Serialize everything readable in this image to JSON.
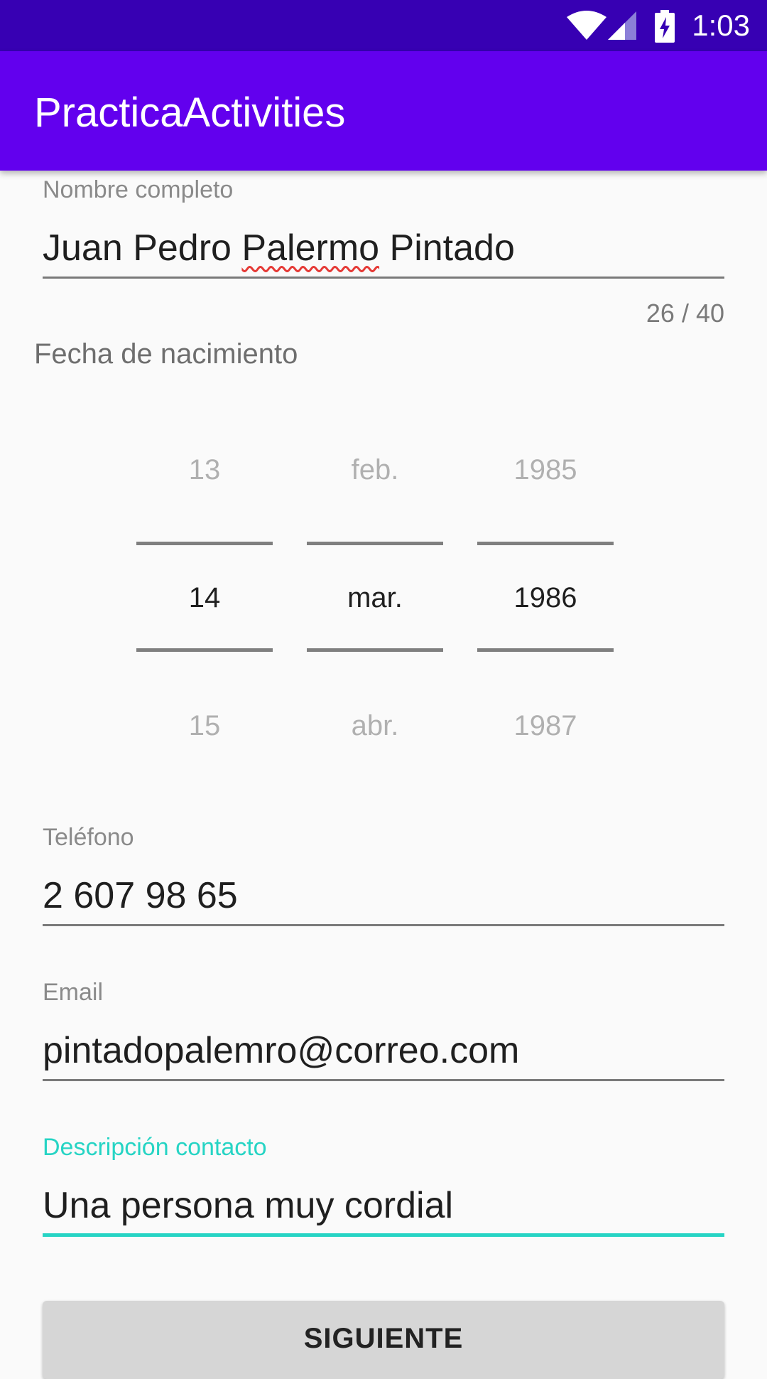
{
  "status_bar": {
    "time": "1:03",
    "icons": [
      "wifi-icon",
      "signal-icon",
      "battery-charging-icon"
    ],
    "background": "#3700b3"
  },
  "app_bar": {
    "title": "PracticaActivities",
    "background": "#6200ee"
  },
  "form": {
    "full_name": {
      "label": "Nombre completo",
      "value_parts": [
        "Juan Pedro ",
        "Palermo",
        " Pintado"
      ],
      "counter": "26 / 40"
    },
    "birth_date": {
      "label": "Fecha de nacimiento",
      "day": {
        "prev": "13",
        "selected": "14",
        "next": "15"
      },
      "month": {
        "prev": "feb.",
        "selected": "mar.",
        "next": "abr."
      },
      "year": {
        "prev": "1985",
        "selected": "1986",
        "next": "1987"
      }
    },
    "phone": {
      "label": "Teléfono",
      "value": "2 607 98 65"
    },
    "email": {
      "label": "Email",
      "value": "pintadopalemro@correo.com"
    },
    "description": {
      "label": "Descripción contacto",
      "value": "Una persona muy cordial",
      "accent_color": "#26d4c4"
    }
  },
  "next_button": {
    "label": "SIGUIENTE"
  }
}
